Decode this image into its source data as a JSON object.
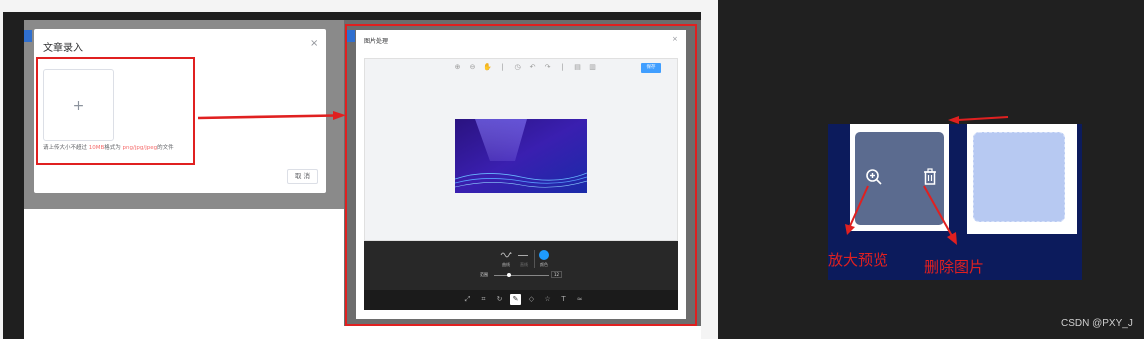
{
  "left_panel": {
    "article_dialog": {
      "title": "文章录入",
      "close_symbol": "×",
      "upload_plus": "+",
      "tip_prefix": "请上传大小不超过 ",
      "tip_size": "10MB",
      "tip_middle": "格式为 ",
      "tip_formats": "png/jpg/jpeg",
      "tip_suffix": "的文件",
      "cancel_label": "取 消"
    },
    "editor_dialog": {
      "title": "图片处理",
      "close_symbol": "×",
      "save_label": "保存",
      "toolbar_icons": [
        "zoom-in-icon",
        "zoom-out-icon",
        "hand-icon",
        "history-icon",
        "undo-icon",
        "redo-icon",
        "reset-icon",
        "delete-icon"
      ],
      "draw_options": [
        {
          "label": "曲线",
          "icon": "curve-icon"
        },
        {
          "label": "直线",
          "icon": "line-icon"
        },
        {
          "label": "颜色",
          "icon": "color-dot-icon"
        }
      ],
      "range_label": "范围",
      "range_value": "12",
      "range_fraction": 0.27,
      "menu_icons": [
        "resize-icon",
        "crop-icon",
        "rotate-icon",
        "draw-icon",
        "shape-icon",
        "icon-icon",
        "text-icon",
        "filter-icon"
      ],
      "active_menu": "draw-icon"
    },
    "colors": {
      "highlight_red": "#e02020",
      "primary_blue": "#409eff"
    }
  },
  "right_panel": {
    "zoom_label": "放大预览",
    "delete_label": "删除图片",
    "watermark": "CSDN @PXY_J"
  }
}
